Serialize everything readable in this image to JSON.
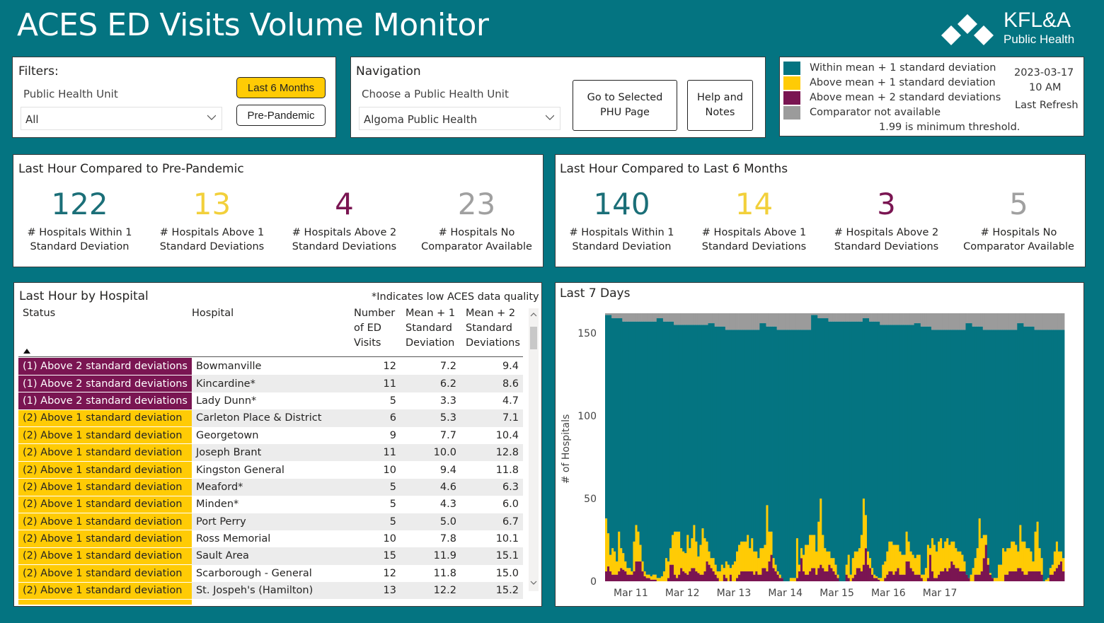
{
  "header": {
    "title": "ACES ED Visits Volume Monitor",
    "logo_line1": "KFL&A",
    "logo_line2": "Public Health",
    "logo_icon": "kfla-diamonds-logo"
  },
  "colors": {
    "background": "#047481",
    "within": "#047481",
    "above1": "#FFCB05",
    "above2": "#7A1552",
    "na": "#9B9B9B"
  },
  "filters": {
    "heading": "Filters:",
    "phu_label": "Public Health Unit",
    "phu_value": "All",
    "btn_last6": "Last 6 Months",
    "btn_prepandemic": "Pre-Pandemic"
  },
  "navigation": {
    "heading": "Navigation",
    "phu_label": "Choose a Public Health Unit",
    "phu_value": "Algoma Public Health",
    "btn_go_line1": "Go to Selected",
    "btn_go_line2": "PHU Page",
    "btn_help_line1": "Help and",
    "btn_help_line2": "Notes"
  },
  "legend": {
    "items": [
      {
        "label": "Within mean + 1 standard deviation",
        "color": "#047481"
      },
      {
        "label": "Above mean + 1 standard deviation",
        "color": "#FFCB05"
      },
      {
        "label": "Above mean + 2 standard deviations",
        "color": "#7A1552"
      },
      {
        "label": "Comparator not available",
        "color": "#9B9B9B"
      }
    ],
    "threshold_note": "1.99 is minimum threshold.",
    "refresh_date": "2023-03-17",
    "refresh_time": "10 AM",
    "refresh_label": "Last Refresh"
  },
  "kpi_prepandemic": {
    "title": "Last Hour Compared to Pre-Pandemic",
    "items": [
      {
        "value": "122",
        "cap1": "# Hospitals Within 1",
        "cap2": "Standard Deviation"
      },
      {
        "value": "13",
        "cap1": "# Hospitals Above 1",
        "cap2": "Standard Deviations"
      },
      {
        "value": "4",
        "cap1": "# Hospitals Above 2",
        "cap2": "Standard Deviations"
      },
      {
        "value": "23",
        "cap1": "# Hospitals No",
        "cap2": "Comparator Available"
      }
    ]
  },
  "kpi_last6": {
    "title": "Last Hour Compared to Last 6 Months",
    "items": [
      {
        "value": "140",
        "cap1": "# Hospitals Within 1",
        "cap2": "Standard Deviation"
      },
      {
        "value": "14",
        "cap1": "# Hospitals Above 1",
        "cap2": "Standard Deviations"
      },
      {
        "value": "3",
        "cap1": "# Hospitals Above 2",
        "cap2": "Standard Deviations"
      },
      {
        "value": "5",
        "cap1": "# Hospitals No",
        "cap2": "Comparator Available"
      }
    ]
  },
  "hospital_table": {
    "title": "Last Hour by Hospital",
    "note": "*Indicates low ACES data quality",
    "columns": {
      "status": "Status",
      "hospital": "Hospital",
      "visits": [
        "Number",
        "of ED",
        "Visits"
      ],
      "mean1": [
        "Mean + 1",
        "Standard",
        "Deviation"
      ],
      "mean2": [
        "Mean + 2",
        "Standard",
        "Deviations"
      ]
    },
    "sort_indicator": "ascending",
    "rows": [
      {
        "status": "(1) Above 2 standard deviations",
        "level": 2,
        "hospital": "Bowmanville",
        "visits": "12",
        "mean1": "7.2",
        "mean2": "9.4"
      },
      {
        "status": "(1) Above 2 standard deviations",
        "level": 2,
        "hospital": "Kincardine*",
        "visits": "11",
        "mean1": "6.2",
        "mean2": "8.6"
      },
      {
        "status": "(1) Above 2 standard deviations",
        "level": 2,
        "hospital": "Lady Dunn*",
        "visits": "5",
        "mean1": "3.3",
        "mean2": "4.7"
      },
      {
        "status": "(2) Above 1 standard deviation",
        "level": 1,
        "hospital": "Carleton Place & District",
        "visits": "6",
        "mean1": "5.3",
        "mean2": "7.1"
      },
      {
        "status": "(2) Above 1 standard deviation",
        "level": 1,
        "hospital": "Georgetown",
        "visits": "9",
        "mean1": "7.7",
        "mean2": "10.4"
      },
      {
        "status": "(2) Above 1 standard deviation",
        "level": 1,
        "hospital": "Joseph Brant",
        "visits": "11",
        "mean1": "10.0",
        "mean2": "12.8"
      },
      {
        "status": "(2) Above 1 standard deviation",
        "level": 1,
        "hospital": "Kingston General",
        "visits": "10",
        "mean1": "9.4",
        "mean2": "11.8"
      },
      {
        "status": "(2) Above 1 standard deviation",
        "level": 1,
        "hospital": "Meaford*",
        "visits": "5",
        "mean1": "4.6",
        "mean2": "6.3"
      },
      {
        "status": "(2) Above 1 standard deviation",
        "level": 1,
        "hospital": "Minden*",
        "visits": "5",
        "mean1": "4.3",
        "mean2": "6.0"
      },
      {
        "status": "(2) Above 1 standard deviation",
        "level": 1,
        "hospital": "Port Perry",
        "visits": "5",
        "mean1": "5.0",
        "mean2": "6.7"
      },
      {
        "status": "(2) Above 1 standard deviation",
        "level": 1,
        "hospital": "Ross Memorial",
        "visits": "10",
        "mean1": "7.8",
        "mean2": "10.1"
      },
      {
        "status": "(2) Above 1 standard deviation",
        "level": 1,
        "hospital": "Sault Area",
        "visits": "15",
        "mean1": "11.9",
        "mean2": "15.1"
      },
      {
        "status": "(2) Above 1 standard deviation",
        "level": 1,
        "hospital": "Scarborough - General",
        "visits": "12",
        "mean1": "11.8",
        "mean2": "15.0"
      },
      {
        "status": "(2) Above 1 standard deviation",
        "level": 1,
        "hospital": "St. Jospeh's (Hamilton)",
        "visits": "13",
        "mean1": "12.2",
        "mean2": "15.2"
      }
    ]
  },
  "chart_data": {
    "type": "bar",
    "stacked": true,
    "title": "Last 7 Days",
    "xlabel": "",
    "ylabel": "# of Hospitals",
    "ylim": [
      0,
      162
    ],
    "yticks": [
      0,
      50,
      100,
      150
    ],
    "xtick_labels": [
      "Mar 11",
      "Mar 12",
      "Mar 13",
      "Mar 14",
      "Mar 15",
      "Mar 16",
      "Mar 17"
    ],
    "total_hospitals": 162,
    "bins_per_day": 24,
    "series_names": [
      "Above mean + 2 standard deviations",
      "Above mean + 1 standard deviation",
      "Within mean + 1 standard deviation",
      "Comparator not available"
    ],
    "above2": [
      6,
      9,
      6,
      4,
      4,
      4,
      6,
      8,
      7,
      6,
      4,
      4,
      4,
      6,
      12,
      12,
      12,
      6,
      3,
      2,
      2,
      1,
      1,
      1,
      0,
      0,
      0,
      0,
      0,
      2,
      10,
      10,
      4,
      2,
      4,
      8,
      6,
      5,
      4,
      6,
      8,
      8,
      6,
      5,
      4,
      4,
      6,
      12,
      10,
      8,
      6,
      4,
      2,
      0,
      0,
      4,
      2,
      0,
      4,
      0,
      0,
      2,
      4,
      6,
      6,
      6,
      6,
      6,
      6,
      4,
      6,
      4,
      4,
      8,
      8,
      6,
      12,
      16,
      8,
      6,
      4,
      2,
      2,
      0,
      0,
      0,
      0,
      0,
      0,
      2,
      6,
      14,
      6,
      4,
      4,
      6,
      8,
      8,
      4,
      8,
      10,
      8,
      6,
      6,
      10,
      8,
      6,
      4,
      2,
      0,
      0,
      0,
      4,
      2,
      0,
      2,
      4,
      8,
      8,
      6,
      10,
      20,
      10,
      8,
      4,
      2,
      2,
      1,
      0,
      0,
      2,
      4,
      6,
      6,
      4,
      6,
      8,
      4,
      4,
      4,
      12,
      12,
      8,
      6,
      4,
      4,
      4,
      2,
      0,
      0,
      2,
      16,
      6,
      2,
      2,
      4,
      6,
      6,
      8,
      6,
      8,
      12,
      10,
      8,
      8,
      6,
      6,
      6,
      4,
      2,
      0,
      0,
      4,
      4,
      4,
      6,
      14,
      22,
      10,
      4,
      2,
      0,
      0,
      0,
      0,
      0,
      4,
      4,
      6,
      6,
      6,
      6,
      8,
      8,
      6,
      4,
      4,
      6,
      6,
      6,
      6,
      6,
      6,
      4,
      0,
      0,
      0,
      4,
      4,
      6,
      8,
      10,
      12,
      6
    ],
    "above1": [
      32,
      20,
      10,
      16,
      14,
      8,
      24,
      12,
      10,
      6,
      4,
      4,
      2,
      18,
      22,
      18,
      10,
      6,
      3,
      2,
      2,
      2,
      3,
      3,
      2,
      2,
      3,
      6,
      14,
      10,
      10,
      18,
      26,
      28,
      26,
      12,
      12,
      12,
      24,
      14,
      18,
      26,
      18,
      10,
      18,
      28,
      20,
      12,
      8,
      6,
      8,
      6,
      4,
      6,
      10,
      4,
      10,
      10,
      4,
      10,
      12,
      16,
      18,
      18,
      18,
      18,
      22,
      14,
      20,
      14,
      12,
      10,
      16,
      12,
      14,
      40,
      18,
      14,
      6,
      4,
      2,
      2,
      0,
      0,
      0,
      0,
      2,
      2,
      2,
      24,
      4,
      6,
      10,
      18,
      18,
      22,
      20,
      20,
      14,
      28,
      40,
      20,
      14,
      12,
      8,
      6,
      8,
      6,
      2,
      0,
      0,
      0,
      6,
      14,
      4,
      12,
      14,
      10,
      12,
      22,
      40,
      20,
      8,
      6,
      4,
      2,
      1,
      1,
      2,
      10,
      10,
      14,
      18,
      18,
      18,
      16,
      14,
      14,
      12,
      12,
      18,
      12,
      10,
      10,
      10,
      12,
      12,
      2,
      4,
      8,
      20,
      4,
      20,
      20,
      16,
      20,
      20,
      14,
      16,
      20,
      14,
      12,
      14,
      12,
      10,
      12,
      10,
      6,
      0,
      0,
      4,
      8,
      10,
      16,
      34,
      20,
      14,
      6,
      4,
      1,
      0,
      2,
      2,
      10,
      10,
      20,
      14,
      16,
      14,
      18,
      18,
      16,
      10,
      26,
      18,
      20,
      16,
      14,
      12,
      6,
      24,
      30,
      14,
      10,
      0,
      1,
      2,
      4,
      6,
      12,
      16,
      8,
      6,
      8,
      12
    ]
  }
}
